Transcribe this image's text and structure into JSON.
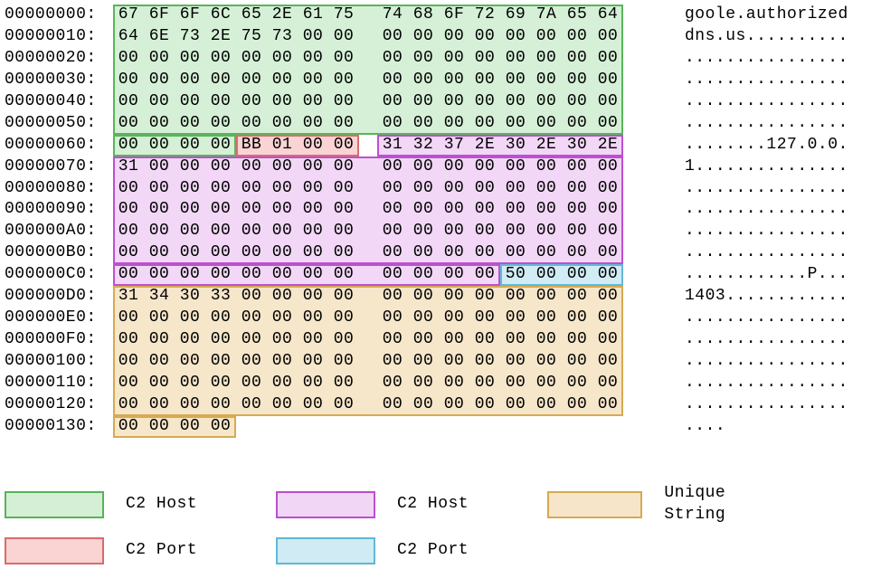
{
  "rows": [
    {
      "addr": "00000000:",
      "hex": [
        "67",
        "6F",
        "6F",
        "6C",
        "65",
        "2E",
        "61",
        "75",
        "74",
        "68",
        "6F",
        "72",
        "69",
        "7A",
        "65",
        "64"
      ],
      "ascii": "goole.authorized"
    },
    {
      "addr": "00000010:",
      "hex": [
        "64",
        "6E",
        "73",
        "2E",
        "75",
        "73",
        "00",
        "00",
        "00",
        "00",
        "00",
        "00",
        "00",
        "00",
        "00",
        "00"
      ],
      "ascii": "dns.us.........."
    },
    {
      "addr": "00000020:",
      "hex": [
        "00",
        "00",
        "00",
        "00",
        "00",
        "00",
        "00",
        "00",
        "00",
        "00",
        "00",
        "00",
        "00",
        "00",
        "00",
        "00"
      ],
      "ascii": "................"
    },
    {
      "addr": "00000030:",
      "hex": [
        "00",
        "00",
        "00",
        "00",
        "00",
        "00",
        "00",
        "00",
        "00",
        "00",
        "00",
        "00",
        "00",
        "00",
        "00",
        "00"
      ],
      "ascii": "................"
    },
    {
      "addr": "00000040:",
      "hex": [
        "00",
        "00",
        "00",
        "00",
        "00",
        "00",
        "00",
        "00",
        "00",
        "00",
        "00",
        "00",
        "00",
        "00",
        "00",
        "00"
      ],
      "ascii": "................"
    },
    {
      "addr": "00000050:",
      "hex": [
        "00",
        "00",
        "00",
        "00",
        "00",
        "00",
        "00",
        "00",
        "00",
        "00",
        "00",
        "00",
        "00",
        "00",
        "00",
        "00"
      ],
      "ascii": "................"
    },
    {
      "addr": "00000060:",
      "hex": [
        "00",
        "00",
        "00",
        "00",
        "BB",
        "01",
        "00",
        "00",
        "31",
        "32",
        "37",
        "2E",
        "30",
        "2E",
        "30",
        "2E"
      ],
      "ascii": "........127.0.0."
    },
    {
      "addr": "00000070:",
      "hex": [
        "31",
        "00",
        "00",
        "00",
        "00",
        "00",
        "00",
        "00",
        "00",
        "00",
        "00",
        "00",
        "00",
        "00",
        "00",
        "00"
      ],
      "ascii": "1..............."
    },
    {
      "addr": "00000080:",
      "hex": [
        "00",
        "00",
        "00",
        "00",
        "00",
        "00",
        "00",
        "00",
        "00",
        "00",
        "00",
        "00",
        "00",
        "00",
        "00",
        "00"
      ],
      "ascii": "................"
    },
    {
      "addr": "00000090:",
      "hex": [
        "00",
        "00",
        "00",
        "00",
        "00",
        "00",
        "00",
        "00",
        "00",
        "00",
        "00",
        "00",
        "00",
        "00",
        "00",
        "00"
      ],
      "ascii": "................"
    },
    {
      "addr": "000000A0:",
      "hex": [
        "00",
        "00",
        "00",
        "00",
        "00",
        "00",
        "00",
        "00",
        "00",
        "00",
        "00",
        "00",
        "00",
        "00",
        "00",
        "00"
      ],
      "ascii": "................"
    },
    {
      "addr": "000000B0:",
      "hex": [
        "00",
        "00",
        "00",
        "00",
        "00",
        "00",
        "00",
        "00",
        "00",
        "00",
        "00",
        "00",
        "00",
        "00",
        "00",
        "00"
      ],
      "ascii": "................"
    },
    {
      "addr": "000000C0:",
      "hex": [
        "00",
        "00",
        "00",
        "00",
        "00",
        "00",
        "00",
        "00",
        "00",
        "00",
        "00",
        "00",
        "50",
        "00",
        "00",
        "00"
      ],
      "ascii": "............P..."
    },
    {
      "addr": "000000D0:",
      "hex": [
        "31",
        "34",
        "30",
        "33",
        "00",
        "00",
        "00",
        "00",
        "00",
        "00",
        "00",
        "00",
        "00",
        "00",
        "00",
        "00"
      ],
      "ascii": "1403............"
    },
    {
      "addr": "000000E0:",
      "hex": [
        "00",
        "00",
        "00",
        "00",
        "00",
        "00",
        "00",
        "00",
        "00",
        "00",
        "00",
        "00",
        "00",
        "00",
        "00",
        "00"
      ],
      "ascii": "................"
    },
    {
      "addr": "000000F0:",
      "hex": [
        "00",
        "00",
        "00",
        "00",
        "00",
        "00",
        "00",
        "00",
        "00",
        "00",
        "00",
        "00",
        "00",
        "00",
        "00",
        "00"
      ],
      "ascii": "................"
    },
    {
      "addr": "00000100:",
      "hex": [
        "00",
        "00",
        "00",
        "00",
        "00",
        "00",
        "00",
        "00",
        "00",
        "00",
        "00",
        "00",
        "00",
        "00",
        "00",
        "00"
      ],
      "ascii": "................"
    },
    {
      "addr": "00000110:",
      "hex": [
        "00",
        "00",
        "00",
        "00",
        "00",
        "00",
        "00",
        "00",
        "00",
        "00",
        "00",
        "00",
        "00",
        "00",
        "00",
        "00"
      ],
      "ascii": "................"
    },
    {
      "addr": "00000120:",
      "hex": [
        "00",
        "00",
        "00",
        "00",
        "00",
        "00",
        "00",
        "00",
        "00",
        "00",
        "00",
        "00",
        "00",
        "00",
        "00",
        "00"
      ],
      "ascii": "................"
    },
    {
      "addr": "00000130:",
      "hex": [
        "00",
        "00",
        "00",
        "00"
      ],
      "ascii": "...."
    }
  ],
  "highlights": [
    {
      "name": "c2-host-1-a",
      "class": "green",
      "row": 0,
      "startCol": 0,
      "endCol": 16,
      "rows": 6
    },
    {
      "name": "c2-host-1-b",
      "class": "green",
      "row": 6,
      "startCol": 0,
      "endCol": 4,
      "rows": 1
    },
    {
      "name": "c2-port-1",
      "class": "red",
      "row": 6,
      "startCol": 4,
      "endCol": 8,
      "rows": 1
    },
    {
      "name": "c2-host-2-a",
      "class": "purple",
      "row": 6,
      "startCol": 8,
      "endCol": 16,
      "rows": 1
    },
    {
      "name": "c2-host-2-b",
      "class": "purple",
      "row": 7,
      "startCol": 0,
      "endCol": 16,
      "rows": 5
    },
    {
      "name": "c2-host-2-c",
      "class": "purple",
      "row": 12,
      "startCol": 0,
      "endCol": 12,
      "rows": 1
    },
    {
      "name": "c2-port-2",
      "class": "blue",
      "row": 12,
      "startCol": 12,
      "endCol": 16,
      "rows": 1
    },
    {
      "name": "unique-str-a",
      "class": "orange",
      "row": 13,
      "startCol": 0,
      "endCol": 16,
      "rows": 6
    },
    {
      "name": "unique-str-b",
      "class": "orange",
      "row": 19,
      "startCol": 0,
      "endCol": 4,
      "rows": 1
    }
  ],
  "legend": [
    {
      "class": "green",
      "label": "C2 Host"
    },
    {
      "class": "purple",
      "label": "C2 Host"
    },
    {
      "class": "orange",
      "label": "Unique String"
    },
    {
      "class": "red",
      "label": "C2 Port"
    },
    {
      "class": "blue",
      "label": "C2 Port"
    }
  ],
  "geometry": {
    "byteW": 34,
    "gapW": 20,
    "rowH": 23.94
  }
}
